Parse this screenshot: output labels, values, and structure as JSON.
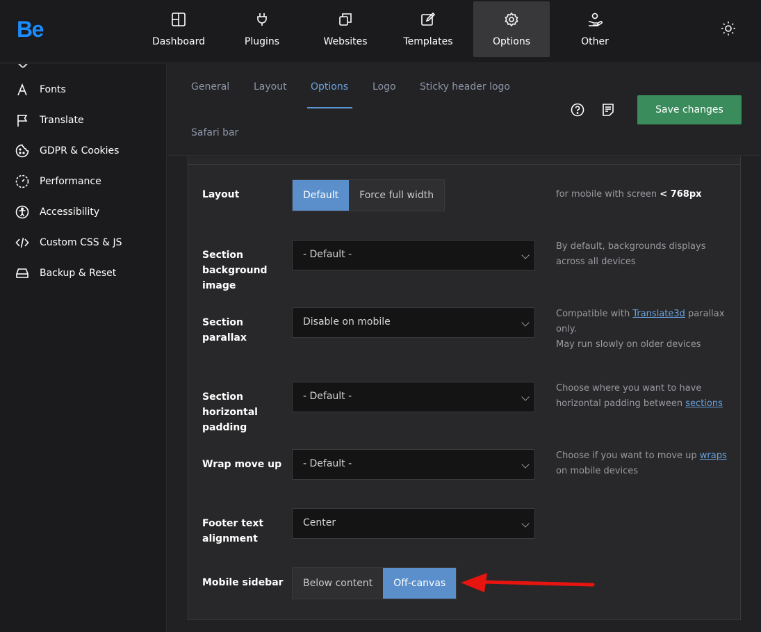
{
  "logo": "Be",
  "nav": {
    "items": [
      {
        "label": "Dashboard",
        "icon": "grid-icon"
      },
      {
        "label": "Plugins",
        "icon": "plug-icon"
      },
      {
        "label": "Websites",
        "icon": "copy-icon"
      },
      {
        "label": "Templates",
        "icon": "edit-icon"
      },
      {
        "label": "Options",
        "icon": "gear-icon",
        "active": true
      },
      {
        "label": "Other",
        "icon": "hand-user-icon"
      }
    ]
  },
  "sidebar": {
    "items": [
      {
        "label": "Fonts",
        "icon": "font-icon"
      },
      {
        "label": "Translate",
        "icon": "flag-icon"
      },
      {
        "label": "GDPR & Cookies",
        "icon": "cookie-icon"
      },
      {
        "label": "Performance",
        "icon": "gauge-icon"
      },
      {
        "label": "Accessibility",
        "icon": "accessibility-icon"
      },
      {
        "label": "Custom CSS & JS",
        "icon": "code-icon"
      },
      {
        "label": "Backup & Reset",
        "icon": "drive-icon"
      }
    ]
  },
  "tabs": {
    "items": [
      "General",
      "Layout",
      "Options",
      "Logo",
      "Sticky header logo",
      "Safari bar"
    ],
    "active": "Options"
  },
  "toolbar": {
    "save_label": "Save changes"
  },
  "options": {
    "layout": {
      "label": "Layout",
      "choices": [
        "Default",
        "Force full width"
      ],
      "selected": "Default",
      "desc_prefix": "for mobile with screen ",
      "desc_strong": "< 768px"
    },
    "bg_image": {
      "label": "Section background image",
      "value": "- Default -",
      "desc": "By default, backgrounds displays across all devices"
    },
    "parallax": {
      "label": "Section parallax",
      "value": "Disable on mobile",
      "desc_prefix": "Compatible with ",
      "desc_link": "Translate3d",
      "desc_suffix": " parallax only.",
      "desc_line2": "May run slowly on older devices"
    },
    "h_padding": {
      "label": "Section horizontal padding",
      "value": "- Default -",
      "desc_prefix": "Choose where you want to have horizontal padding between ",
      "desc_link": "sections"
    },
    "wrap_move": {
      "label": "Wrap move up",
      "value": "- Default -",
      "desc_prefix": "Choose if you want to move up ",
      "desc_link": "wraps",
      "desc_suffix": " on mobile devices"
    },
    "footer_align": {
      "label": "Footer text alignment",
      "value": "Center"
    },
    "mobile_sidebar": {
      "label": "Mobile sidebar",
      "choices": [
        "Below content",
        "Off-canvas"
      ],
      "selected": "Off-canvas"
    }
  },
  "colors": {
    "accent": "#5a8fcb",
    "save": "#3a8c5c",
    "arrow": "#e8140f"
  }
}
